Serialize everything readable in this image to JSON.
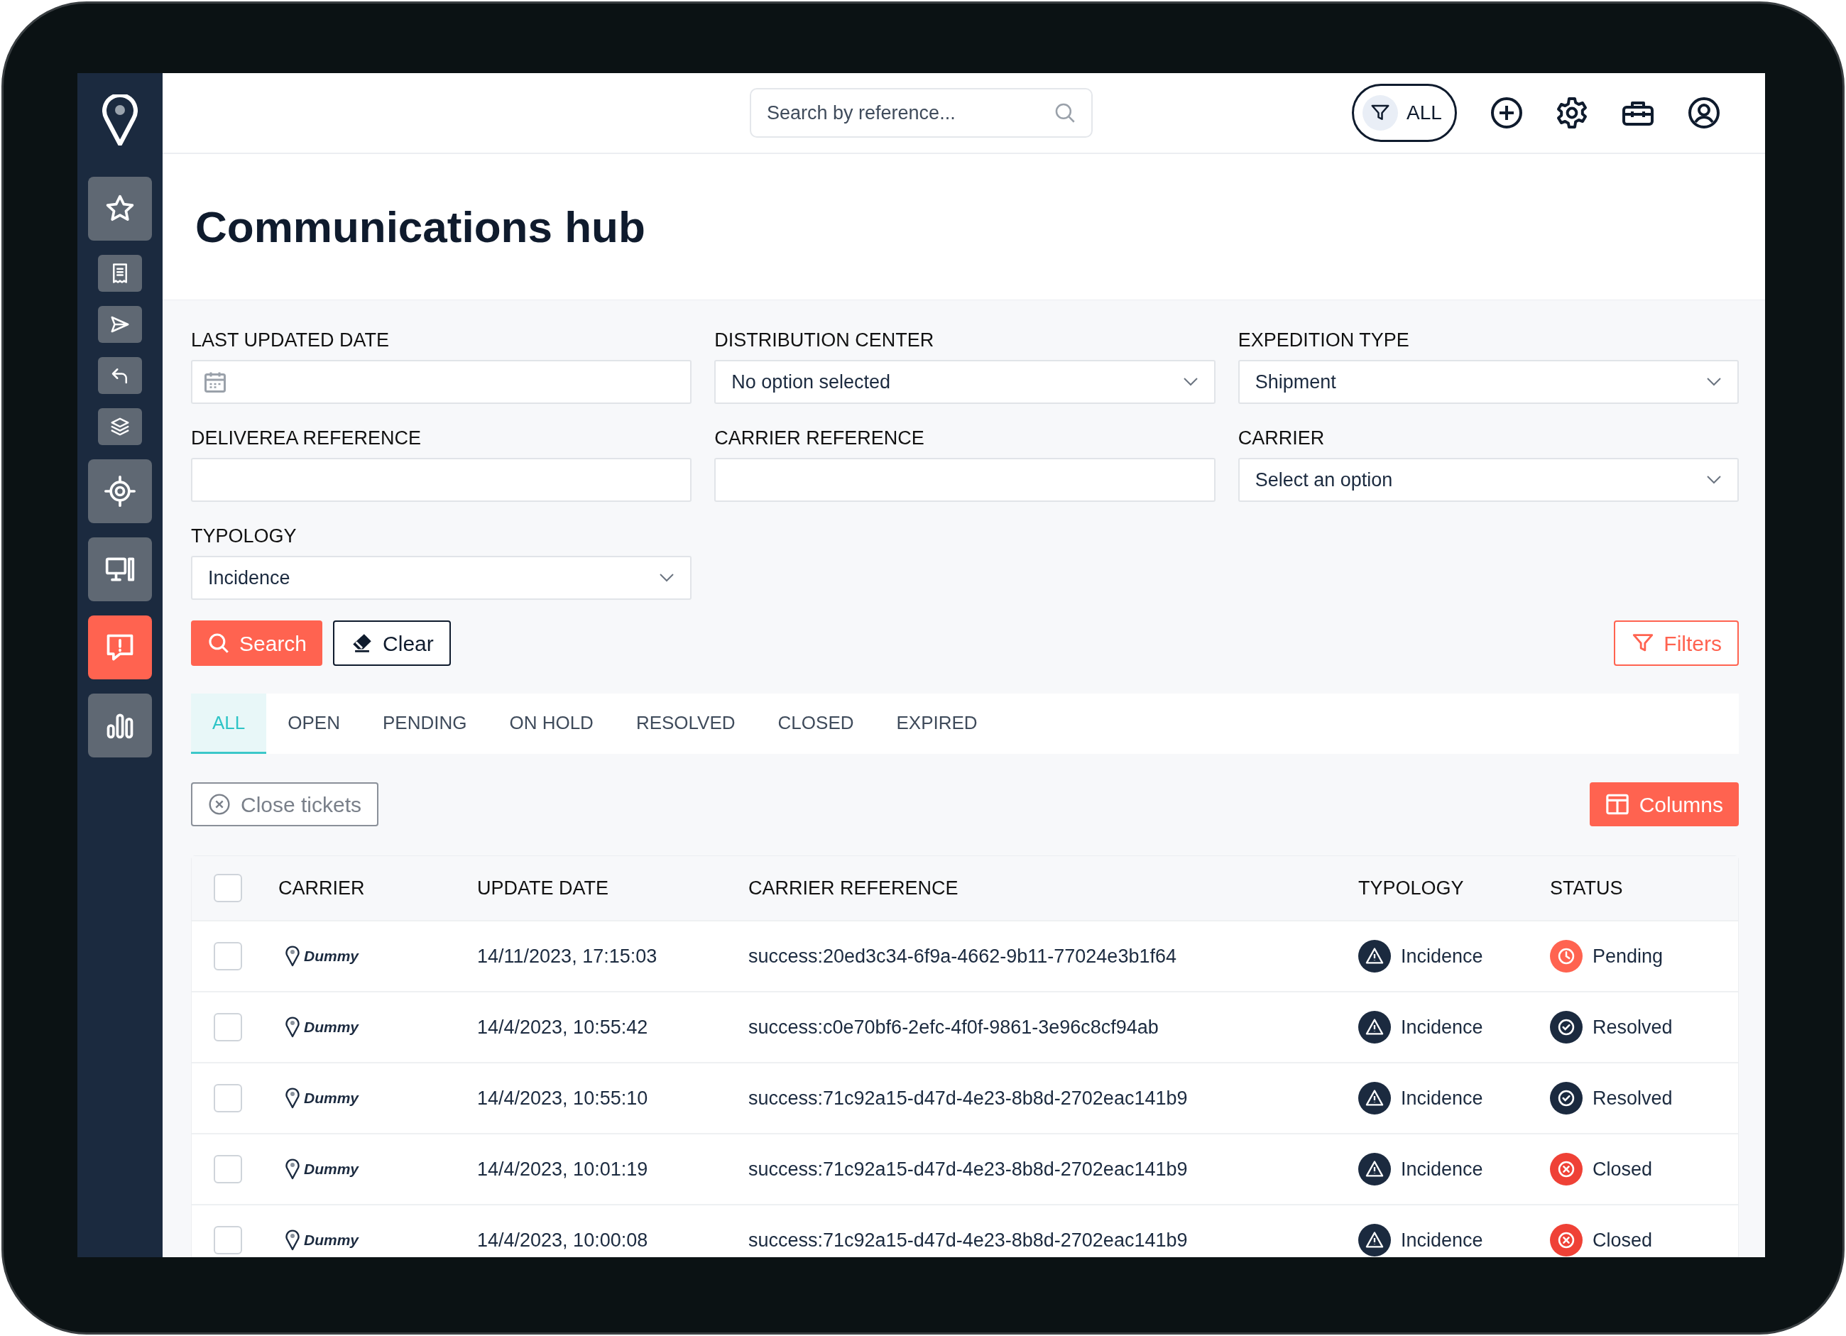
{
  "sidebar": {
    "items": [
      {
        "kind": "large",
        "selected": false
      },
      {
        "kind": "small",
        "selected": false
      },
      {
        "kind": "small",
        "selected": false
      },
      {
        "kind": "small",
        "selected": false
      },
      {
        "kind": "small",
        "selected": false
      },
      {
        "kind": "large",
        "selected": false
      },
      {
        "kind": "large",
        "selected": false
      },
      {
        "kind": "large",
        "selected": true
      },
      {
        "kind": "large",
        "selected": false
      }
    ]
  },
  "topbar": {
    "search": {
      "placeholder": "Search by reference..."
    },
    "filter_pill": "ALL"
  },
  "page_title": "Communications hub",
  "filters": [
    {
      "label": "LAST UPDATED DATE",
      "kind": "date"
    },
    {
      "label": "DISTRIBUTION CENTER",
      "kind": "select",
      "value": "No option selected"
    },
    {
      "label": "EXPEDITION TYPE",
      "kind": "select",
      "value": "Shipment"
    },
    {
      "label": "DELIVEREA REFERENCE",
      "kind": "text"
    },
    {
      "label": "CARRIER REFERENCE",
      "kind": "text"
    },
    {
      "label": "CARRIER",
      "kind": "select",
      "value": "Select an option"
    },
    {
      "label": "TYPOLOGY",
      "kind": "select",
      "value": "Incidence"
    }
  ],
  "actions": {
    "search": "Search",
    "clear": "Clear",
    "filters": "Filters"
  },
  "tabs": [
    {
      "label": "ALL",
      "selected": true
    },
    {
      "label": "OPEN",
      "selected": false
    },
    {
      "label": "PENDING",
      "selected": false
    },
    {
      "label": "ON HOLD",
      "selected": false
    },
    {
      "label": "RESOLVED",
      "selected": false
    },
    {
      "label": "CLOSED",
      "selected": false
    },
    {
      "label": "EXPIRED",
      "selected": false
    }
  ],
  "toolbar": {
    "close_tickets": "Close tickets",
    "columns": "Columns"
  },
  "table": {
    "select_all_checked": false,
    "columns": [
      "CARRIER",
      "UPDATE DATE",
      "CARRIER REFERENCE",
      "TYPOLOGY",
      "STATUS"
    ],
    "rows": [
      {
        "checked": false,
        "carrier": "Dummy",
        "date": "14/11/2023, 17:15:03",
        "reference": "success:20ed3c34-6f9a-4662-9b11-77024e3b1f64",
        "typology": "Incidence",
        "status": {
          "kind": "pending",
          "label": "Pending"
        }
      },
      {
        "checked": false,
        "carrier": "Dummy",
        "date": "14/4/2023, 10:55:42",
        "reference": "success:c0e70bf6-2efc-4f0f-9861-3e96c8cf94ab",
        "typology": "Incidence",
        "status": {
          "kind": "resolved",
          "label": "Resolved"
        }
      },
      {
        "checked": false,
        "carrier": "Dummy",
        "date": "14/4/2023, 10:55:10",
        "reference": "success:71c92a15-d47d-4e23-8b8d-2702eac141b9",
        "typology": "Incidence",
        "status": {
          "kind": "resolved",
          "label": "Resolved"
        }
      },
      {
        "checked": false,
        "carrier": "Dummy",
        "date": "14/4/2023, 10:01:19",
        "reference": "success:71c92a15-d47d-4e23-8b8d-2702eac141b9",
        "typology": "Incidence",
        "status": {
          "kind": "closed",
          "label": "Closed"
        }
      },
      {
        "checked": false,
        "carrier": "Dummy",
        "date": "14/4/2023, 10:00:08",
        "reference": "success:71c92a15-d47d-4e23-8b8d-2702eac141b9",
        "typology": "Incidence",
        "status": {
          "kind": "closed",
          "label": "Closed"
        }
      }
    ]
  }
}
